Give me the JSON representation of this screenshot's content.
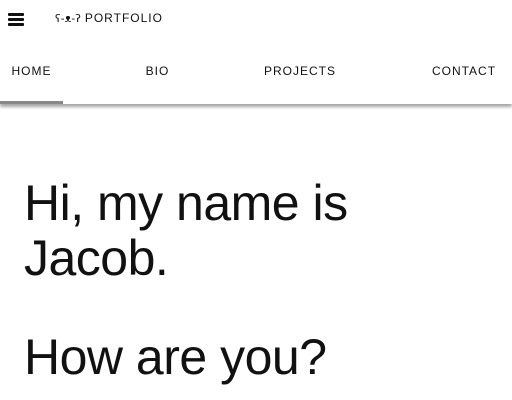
{
  "header": {
    "menu_icon": "hamburger-menu-icon",
    "brand_face": "ʕ-ᴥ-ʔ",
    "brand_text": "PORTFOLIO"
  },
  "tabs": [
    {
      "label": "HOME",
      "active": true
    },
    {
      "label": "BIO",
      "active": false
    },
    {
      "label": "PROJECTS",
      "active": false
    },
    {
      "label": "CONTACT",
      "active": false
    }
  ],
  "hero": {
    "line1": "Hi, my name is",
    "line2": "Jacob.",
    "question": "How are you?"
  },
  "colors": {
    "indicator": "#888888",
    "text": "#111111",
    "background": "#ffffff"
  }
}
